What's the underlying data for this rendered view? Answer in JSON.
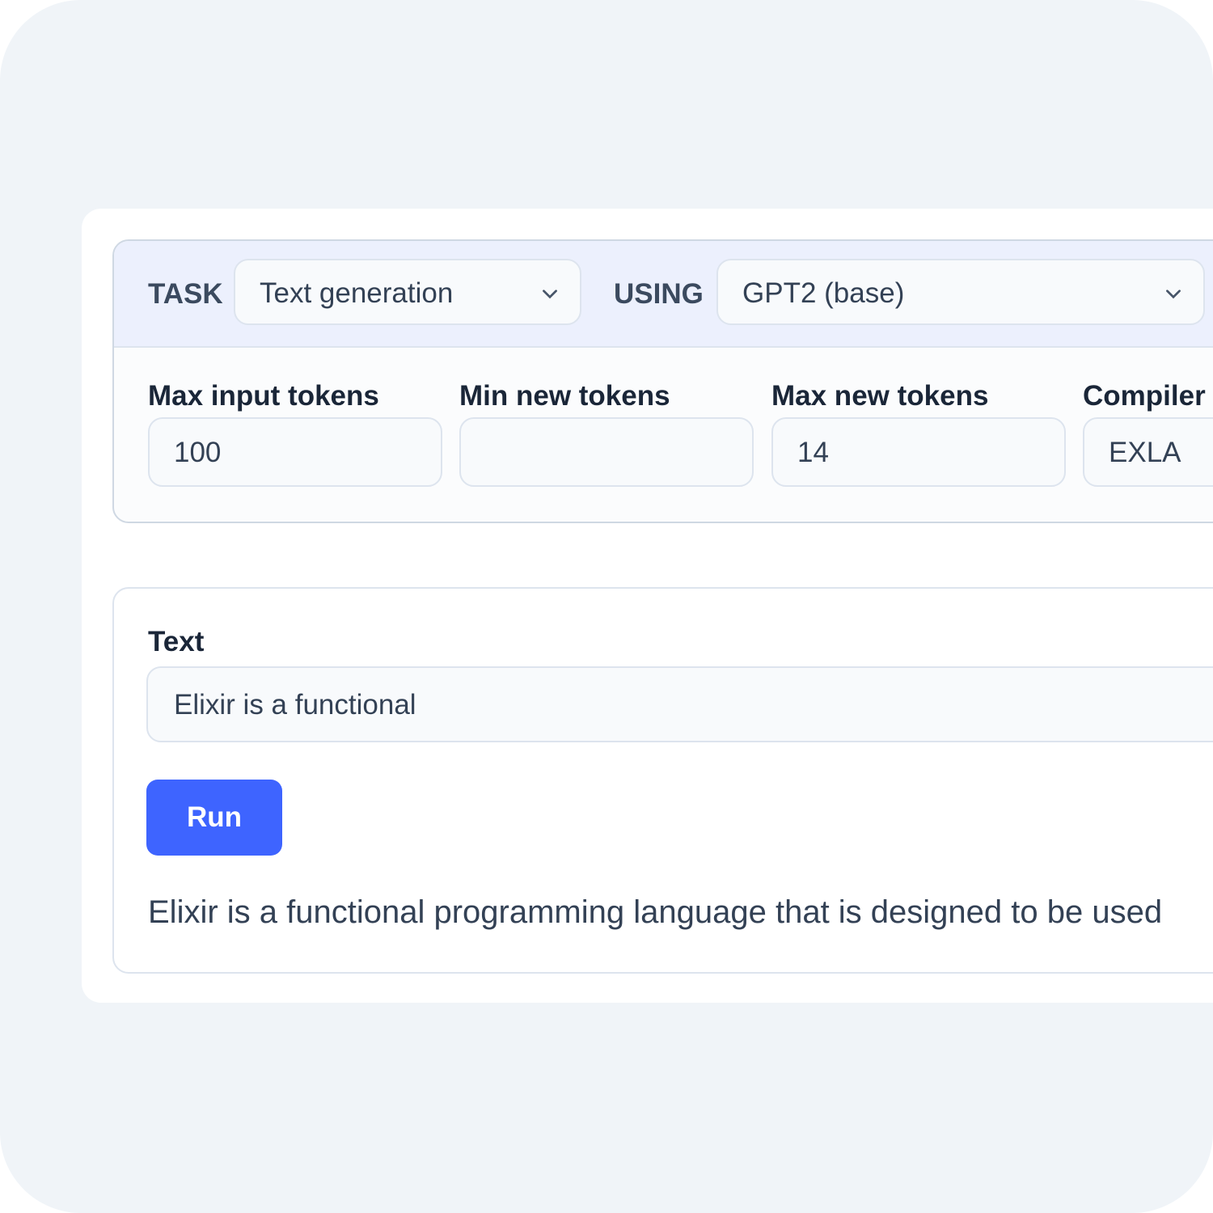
{
  "header": {
    "task_label": "TASK",
    "task_value": "Text generation",
    "using_label": "USING",
    "model_value": "GPT2 (base)"
  },
  "fields": [
    {
      "label": "Max input tokens",
      "value": "100"
    },
    {
      "label": "Min new tokens",
      "value": ""
    },
    {
      "label": "Max new tokens",
      "value": "14"
    },
    {
      "label": "Compiler",
      "value": "EXLA"
    }
  ],
  "text_input": {
    "label": "Text",
    "value": "Elixir is a functional"
  },
  "run_label": "Run",
  "output": "Elixir is a functional programming language that is designed to be used",
  "colors": {
    "accent": "#3e64ff",
    "header_bg": "#ecf0fd",
    "page_bg": "#f0f4f8"
  }
}
